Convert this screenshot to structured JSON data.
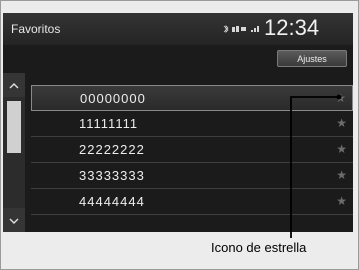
{
  "header": {
    "title": "Favoritos",
    "clock": "12:34"
  },
  "buttons": {
    "settings_label": "Ajustes"
  },
  "list": {
    "items": [
      {
        "number": "00000000",
        "star": "★"
      },
      {
        "number": "11111111",
        "star": "★"
      },
      {
        "number": "22222222",
        "star": "★"
      },
      {
        "number": "33333333",
        "star": "★"
      },
      {
        "number": "44444444",
        "star": "★"
      }
    ],
    "selected_index": 0
  },
  "scroll": {
    "up_icon": "^",
    "down_icon": "v"
  },
  "callout": {
    "label": "Icono de estrella"
  }
}
